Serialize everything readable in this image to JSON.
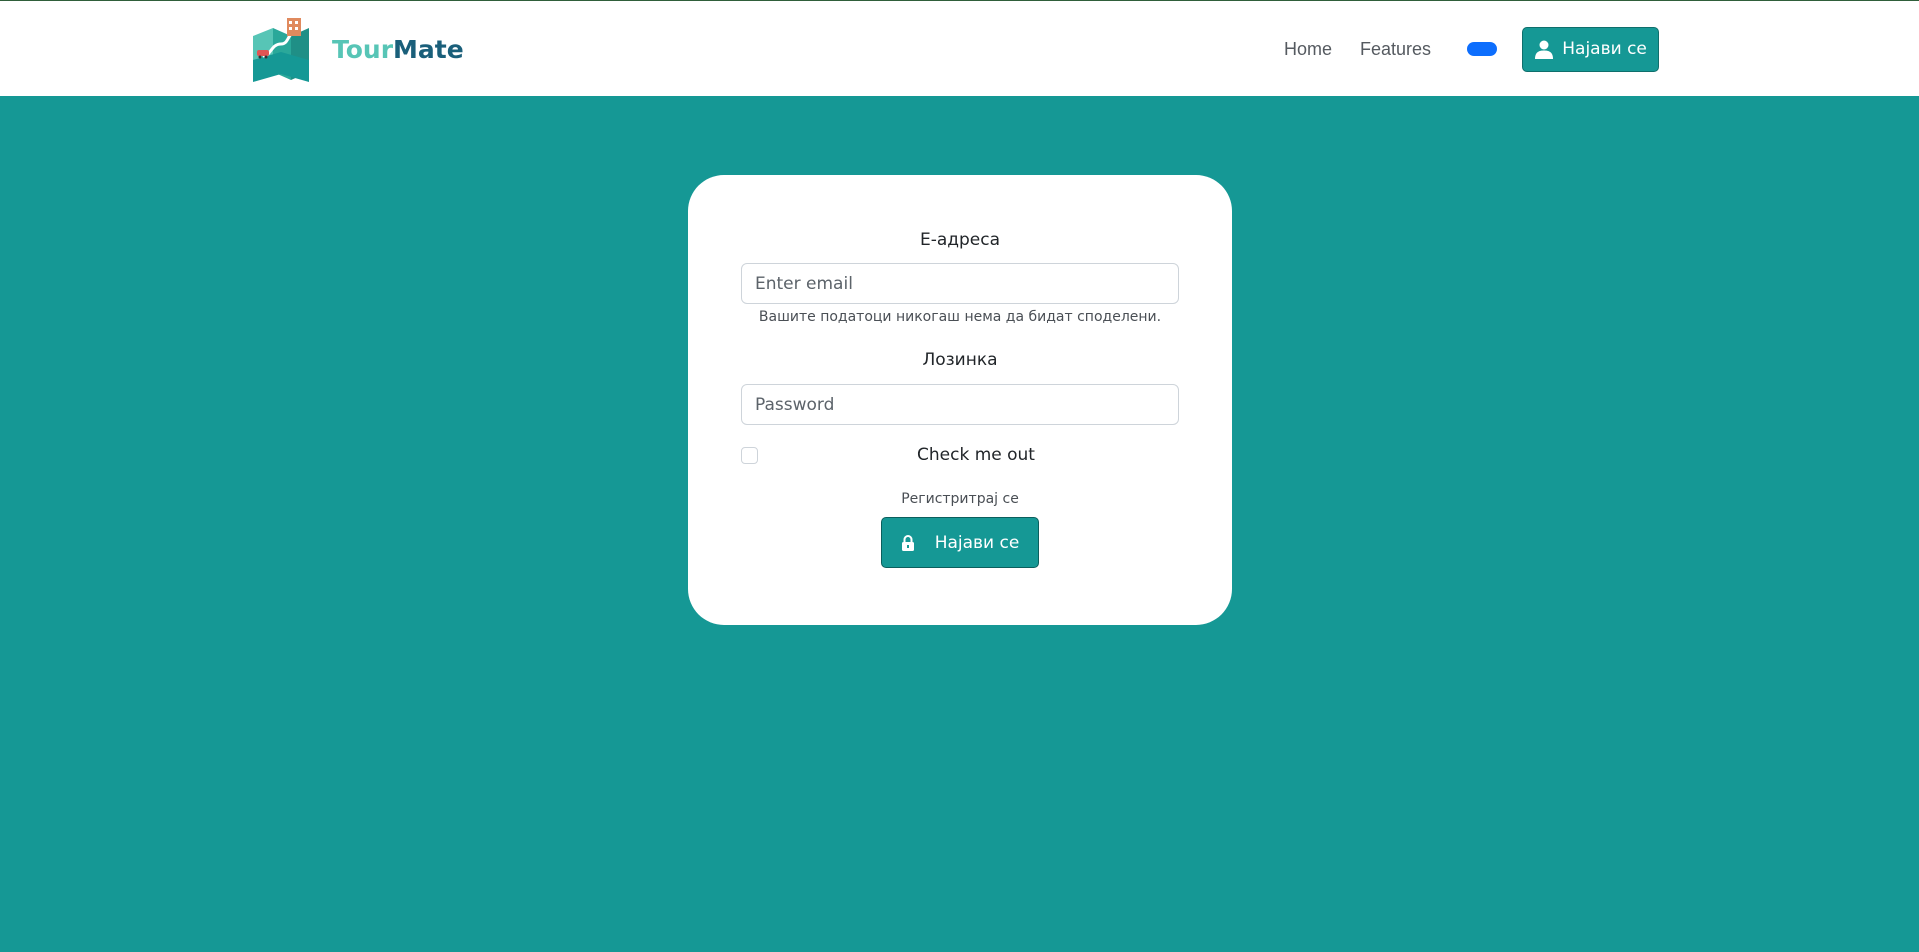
{
  "brand": {
    "name_part1": "Tour",
    "name_part2": "Mate",
    "logo_icon": "map-logo-icon",
    "colors": {
      "tour": "#57c5b6",
      "mate": "#1a5f7a"
    }
  },
  "nav": {
    "links": [
      {
        "label": "Home"
      },
      {
        "label": "Features"
      }
    ],
    "toggle_color": "#0d6efd",
    "login_button": {
      "label": "Најави се",
      "icon": "person-icon"
    }
  },
  "form": {
    "email": {
      "label": "Е-адреса",
      "placeholder": "Enter email",
      "value": "",
      "help": "Вашите податоци никогаш нема да бидат споделени."
    },
    "password": {
      "label": "Лозинка",
      "placeholder": "Password",
      "value": ""
    },
    "remember": {
      "label": "Check me out",
      "checked": false
    },
    "register_link": "Регистритрај се",
    "submit": {
      "label": "Најави се",
      "icon": "lock-icon"
    }
  },
  "colors": {
    "background": "#159895",
    "primary": "#159895",
    "card": "#ffffff"
  }
}
